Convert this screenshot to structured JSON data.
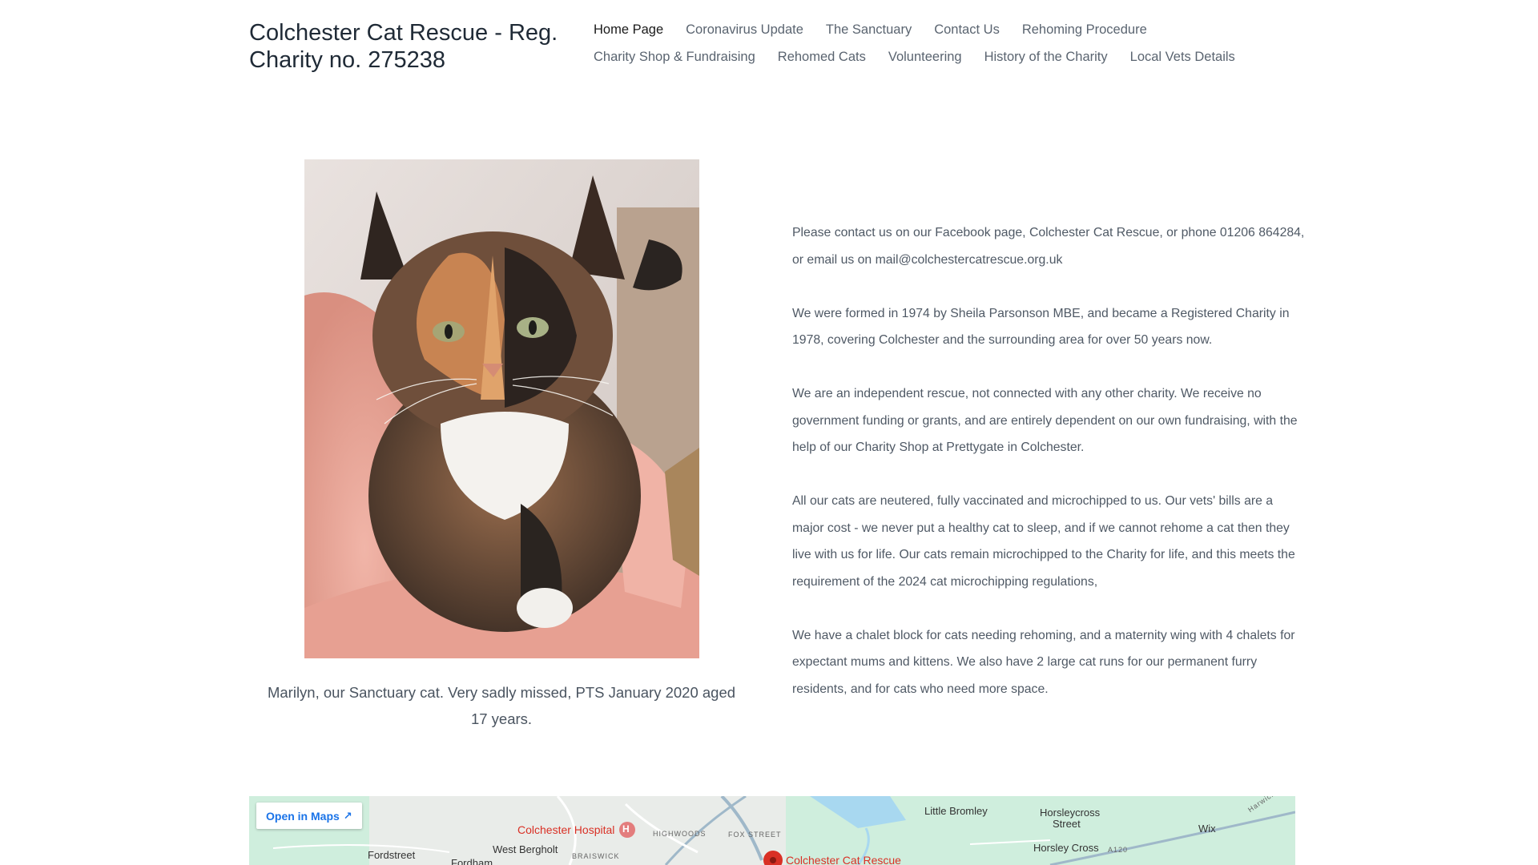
{
  "site": {
    "title": "Colchester Cat Rescue - Reg. Charity no. 275238"
  },
  "nav": {
    "items": [
      {
        "label": "Home Page",
        "active": true
      },
      {
        "label": "Coronavirus Update",
        "active": false
      },
      {
        "label": "The Sanctuary",
        "active": false
      },
      {
        "label": "Contact Us",
        "active": false
      },
      {
        "label": "Rehoming Procedure",
        "active": false
      },
      {
        "label": "Charity Shop & Fundraising",
        "active": false
      },
      {
        "label": "Rehomed Cats",
        "active": false
      },
      {
        "label": "Volunteering",
        "active": false
      },
      {
        "label": "History of the Charity",
        "active": false
      },
      {
        "label": "Local Vets Details",
        "active": false
      }
    ]
  },
  "feature": {
    "caption": "Marilyn, our Sanctuary cat. Very sadly missed, PTS January 2020 aged 17 years."
  },
  "content": {
    "paragraphs": [
      "Please contact us on our Facebook page, Colchester Cat Rescue, or phone 01206 864284, or email us on mail@colchestercatrescue.org.uk",
      "We were formed in 1974 by Sheila Parsonson MBE, and became a Registered Charity in 1978, covering Colchester and the surrounding area for over 50 years now.",
      "We are an independent rescue, not connected with any other charity. We receive no government funding or grants, and are entirely dependent on our own fundraising, with the help of our Charity Shop at Prettygate in Colchester.",
      "All our cats are neutered, fully vaccinated and microchipped to us. Our vets' bills are a major cost - we never put a healthy cat to sleep, and if we cannot rehome a cat then they live with us for life. Our cats remain microchipped to the Charity for life, and this meets the requirement of the 2024 cat microchipping regulations,",
      "We have a chalet block for cats needing rehoming, and a maternity wing with 4 chalets for expectant mums and kittens. We also have 2 large cat runs for our permanent furry residents, and for cats who need more space."
    ]
  },
  "map": {
    "open_label": "Open in Maps",
    "places": {
      "hospital": "Colchester Hospital",
      "highwoods": "HIGHWOODS",
      "fox_street": "FOX STREET",
      "little_bromley": "Little Bromley",
      "horsleycross_street_1": "Horsleycross",
      "horsleycross_street_2": "Street",
      "horsley_cross": "Horsley Cross",
      "a120": "A120",
      "wix": "Wix",
      "harwich": "Harwich R",
      "fordstreet": "Fordstreet",
      "west_bergholt": "West Bergholt",
      "fordham": "Fordham",
      "braiswick": "BRAISWICK",
      "rescue_pin": "Colchester Cat Rescue"
    },
    "colors": {
      "land": "#cfeedd",
      "road": "#ffffff",
      "water": "#a8d8f0",
      "pin": "#d93025"
    }
  }
}
